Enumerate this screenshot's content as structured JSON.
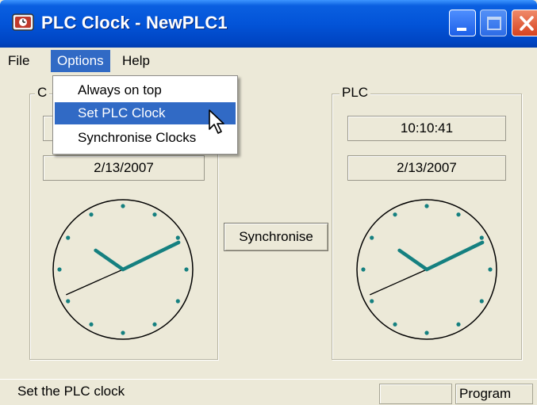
{
  "window": {
    "title": "PLC Clock - NewPLC1"
  },
  "menu": {
    "file": "File",
    "options": "Options",
    "help": "Help"
  },
  "options_menu": {
    "items": [
      "Always on top",
      "Set PLC Clock",
      "Synchronise Clocks"
    ],
    "highlighted": "Set PLC Clock"
  },
  "computer_panel": {
    "label": "C",
    "time": "",
    "date": "2/13/2007",
    "clock_time": "10:10:41"
  },
  "plc_panel": {
    "label": "PLC",
    "time": "10:10:41",
    "date": "2/13/2007",
    "clock_time": "10:10:41"
  },
  "sync_button": "Synchronise",
  "status": {
    "text": "Set the PLC clock",
    "pane_1": "",
    "mode": "Program"
  },
  "colors": {
    "titlebar": "#0354d8",
    "selection": "#316ac5",
    "hands": "#158080",
    "face": "#ece9d8"
  },
  "icons": {
    "app": "plc-clock-app-icon",
    "minimize": "minimize-icon",
    "maximize": "maximize-icon",
    "close": "close-icon",
    "cursor": "mouse-pointer-icon"
  }
}
